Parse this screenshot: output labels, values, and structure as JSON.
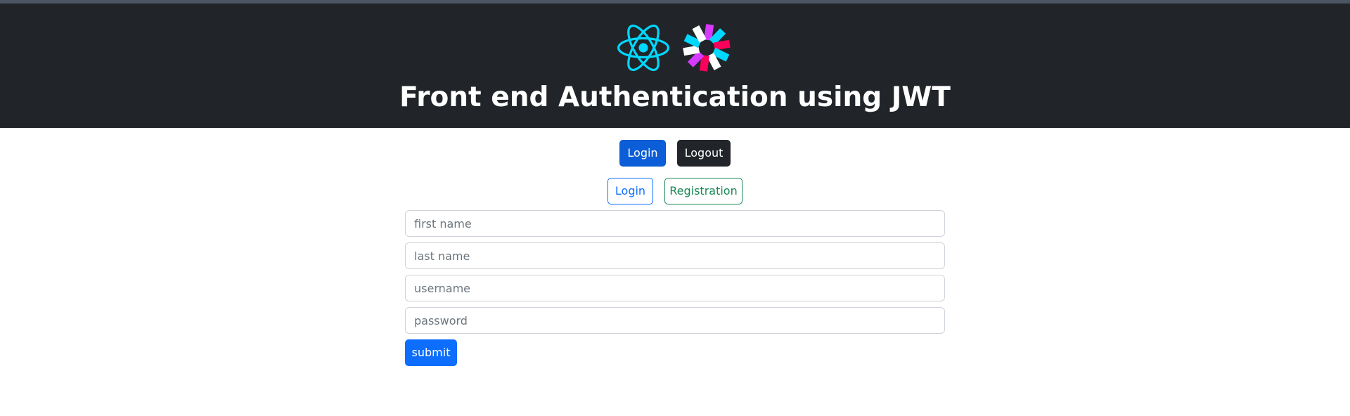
{
  "header": {
    "title": "Front end Authentication using JWT",
    "logos": [
      "react-logo",
      "jwt-logo"
    ]
  },
  "top_nav": {
    "login_label": "Login",
    "logout_label": "Logout"
  },
  "tabs": {
    "login_label": "Login",
    "registration_label": "Registration"
  },
  "form": {
    "first_name_placeholder": "first name",
    "last_name_placeholder": "last name",
    "username_placeholder": "username",
    "password_placeholder": "password",
    "submit_label": "submit"
  },
  "colors": {
    "header_bg": "#212529",
    "primary": "#0d6efd",
    "success": "#198754",
    "react_blue": "#00d8ff"
  }
}
